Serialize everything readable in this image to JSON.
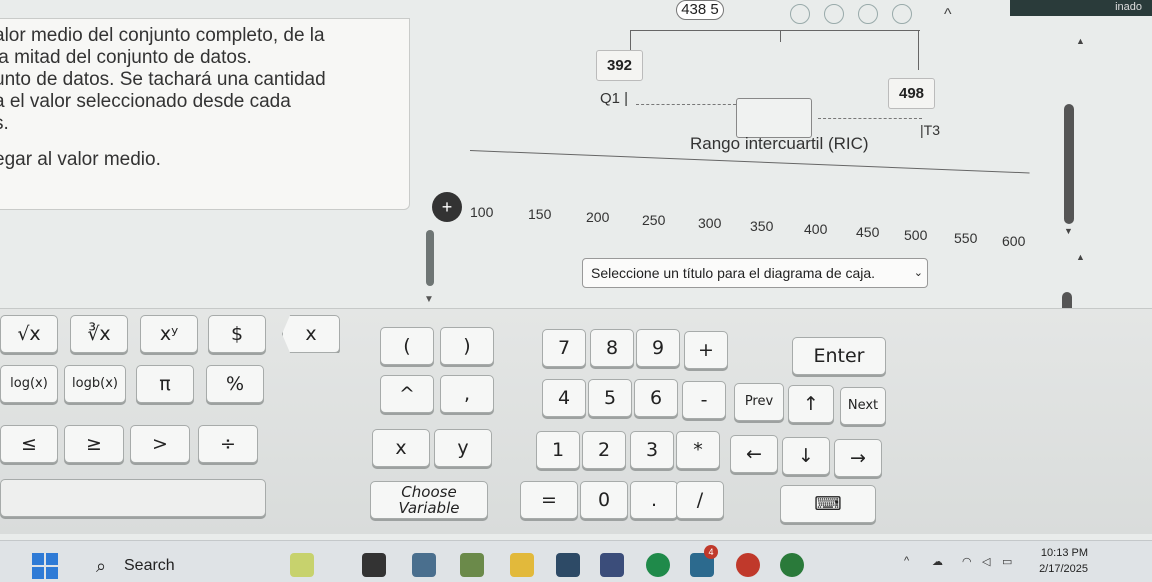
{
  "instructions": {
    "lines": [
      "alor medio del conjunto completo, de la",
      "la mitad del conjunto de datos.",
      "unto de datos. Se tachará una cantidad",
      "a el valor seleccionado desde cada",
      "s.",
      "egar al valor medio."
    ]
  },
  "top": {
    "badge": "438 5",
    "corner_text": "inado"
  },
  "boxplot": {
    "min_value": "392",
    "max_value": "498",
    "q1_label": "Q1",
    "q3_label": "T3",
    "iqr_label": "Rango intercuartil (RIC)",
    "drag_icon": "+"
  },
  "axis": {
    "ticks": [
      "100",
      "150",
      "200",
      "250",
      "300",
      "350",
      "400",
      "450",
      "500",
      "550",
      "600"
    ]
  },
  "title_select": {
    "value": "Seleccione un título para el diagrama de caja.",
    "chevron": "⌄"
  },
  "keypad": {
    "sqrt": "√x",
    "nthroot": "∛x",
    "power": "xʸ",
    "dollar": "$",
    "backspace": "x",
    "lparen": "(",
    "rparen": ")",
    "k7": "7",
    "k8": "8",
    "k9": "9",
    "plus": "+",
    "enter": "Enter",
    "log": "log(x)",
    "logb": "logb(x)",
    "pi": "π",
    "percent": "%",
    "caret": "^",
    "comma": ",",
    "k4": "4",
    "k5": "5",
    "k6": "6",
    "minus": "-",
    "prev": "Prev",
    "up": "↑",
    "next": "Next",
    "le": "≤",
    "ge": "≥",
    "gt": ">",
    "divide": "÷",
    "x": "x",
    "y": "y",
    "k1": "1",
    "k2": "2",
    "k3": "3",
    "times": "*",
    "left": "←",
    "down": "↓",
    "right": "→",
    "choose_variable": "Choose Variable",
    "equals": "=",
    "k0": "0",
    "dot": ".",
    "slash": "/"
  },
  "taskbar": {
    "search_label": "Search",
    "badge_count": "4",
    "time": "10:13 PM",
    "date": "2/17/2025"
  },
  "colors": {
    "windows_blue": "#2f7bd6"
  }
}
